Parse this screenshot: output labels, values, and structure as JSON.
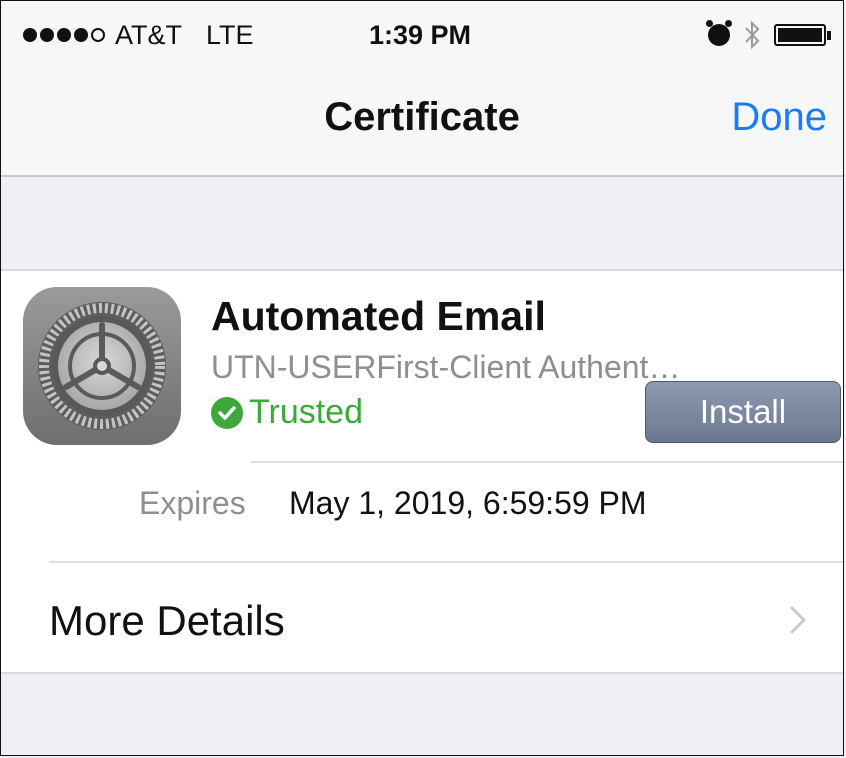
{
  "status_bar": {
    "carrier": "AT&T",
    "network": "LTE",
    "time": "1:39 PM"
  },
  "nav": {
    "title": "Certificate",
    "done_label": "Done"
  },
  "certificate": {
    "name": "Automated Email",
    "issuer": "UTN-USERFirst-Client Authent…",
    "trust_status": "Trusted",
    "install_label": "Install",
    "expires_label": "Expires",
    "expires_value": "May 1, 2019, 6:59:59 PM",
    "more_details_label": "More Details",
    "icon": "settings-gear-icon"
  },
  "colors": {
    "accent": "#1a7cf5",
    "trusted_green": "#3da83a",
    "install_button": "#7a86a0"
  }
}
